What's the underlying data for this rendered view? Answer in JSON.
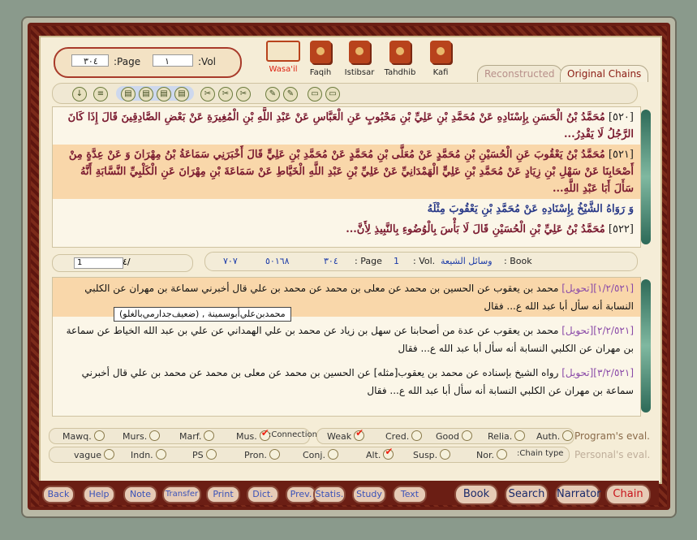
{
  "nav": {
    "page_label": ":Page",
    "vol_label": ":Vol",
    "page_value": "٣٠٤",
    "vol_value": "١"
  },
  "books": [
    {
      "label": "Wasa'il",
      "active": true
    },
    {
      "label": "Faqih"
    },
    {
      "label": "Istibsar"
    },
    {
      "label": "Tahdhib"
    },
    {
      "label": "Kafi"
    }
  ],
  "tabs": {
    "reconstructed": "Reconstructed",
    "original": "Original Chains"
  },
  "text": {
    "p1_num": "[٥٢٠]",
    "p1": "مُحَمَّدُ بْنُ الْحَسَنِ بِإِسْنَادِهِ عَنْ مُحَمَّدِ بْنِ عَلِيِّ بْنِ مَحْبُوبٍ عَنِ الْعَبَّاسِ عَنْ عَبْدِ اللَّهِ بْنِ الْمُغِيرَةِ عَنْ بَعْضِ الصَّادِقِينَ قَالَ إِذَا كَانَ الرَّجُلُ لَا يَقْدِرُ...",
    "p2_num": "[٥٢١]",
    "p2": "مُحَمَّدُ بْنُ يَعْقُوبَ عَنِ الْحُسَيْنِ بْنِ مُحَمَّدٍ عَنْ مُعَلَّى بْنِ مُحَمَّدٍ عَنْ مُحَمَّدِ بْنِ عَلِيٍّ قَالَ أَخْبَرَنِي سَمَاعَةُ بْنُ مِهْرَانَ وَ عَنْ عِدَّةٍ مِنْ أَصْحَابِنَا عَنْ سَهْلِ بْنِ زِيَادٍ عَنْ مُحَمَّدِ بْنِ عَلِيٍّ الْهَمْدَانِيِّ عَنْ عَلِيِّ بْنِ عَبْدِ اللَّهِ الْخَيَّاطِ عَنْ سَمَاعَةَ بْنِ مِهْرَانَ عَنِ الْكَلْبِيِّ النَّسَّابَةِ أَنَّهُ سَأَلَ أَبَا عَبْدِ اللَّهِ...",
    "p3": "وَ رَوَاهُ الشَّيْخُ بِإِسْنَادِهِ عَنْ مُحَمَّدِ بْنِ يَعْقُوبَ مِثْلَهُ",
    "p4_num": "[٥٢٢]",
    "p4": "مُحَمَّدُ بْنُ عَلِيِّ بْنِ الْحُسَيْنِ قَالَ لَا بَأْسَ بِالْوُضُوءِ بِالنَّبِيذِ لِأَنَّ..."
  },
  "info": {
    "book_label": ": Book",
    "book_name": "وسائل الشيعة",
    "vol_label": ": Vol.",
    "vol_value": "1",
    "page_label": ": Page",
    "page_value": "٣٠٤",
    "hadith_no": "٥٠١٦٨",
    "count": "٧٠٧"
  },
  "pager": {
    "total": "٤/",
    "current": "1"
  },
  "chains": {
    "c1_tag": "[١/٢/٥٢١][تحويل]",
    "c1": "محمد بن يعقوب عن الحسين بن محمد عن معلى بن محمد عن محمد بن علي قال أخبرني سماعة بن مهران عن الكلبي النسابة أنه سأل أبا عبد الله ع... فقال",
    "c2_tag": "[٢/٢/٥٢١][تحويل]",
    "c2": "محمد بن يعقوب عن عدة من أصحابنا عن سهل بن زياد عن محمد بن علي الهمداني عن علي بن عبد الله الخياط عن سماعة بن مهران عن الكلبي النسابة أنه سأل أبا عبد الله ع... فقال",
    "c3_tag": "[٣/٢/٥٢١][تحويل]",
    "c3": "رواه الشيخ بإسناده عن محمد بن يعقوب[مثله] عن الحسين بن محمد عن معلى بن محمد عن محمد بن علي قال أخبرني سماعة بن مهران عن الكلبي النسابة أنه سأل أبا عبد الله ع... فقال",
    "tooltip": "محمدبن‌علي‌أبوسمينة , (ضعيف‌جدا‌رمي‌بالغلو)"
  },
  "eval_row1": {
    "mawq": "Mawq.",
    "murs": "Murs.",
    "marf": "Marf.",
    "mus": "Mus.",
    "connection": ":Connection",
    "weak": "Weak",
    "cred": "Cred.",
    "good": "Good",
    "relia": "Relia.",
    "auth": "Auth.",
    "program": "Program's eval."
  },
  "eval_row2": {
    "vague": "vague",
    "indn": "Indn.",
    "ps": "PS",
    "pron": "Pron.",
    "conj": "Conj.",
    "alt": "Alt.",
    "susp": "Susp.",
    "nor": "Nor.",
    "chaintype": ":Chain type",
    "personal": "Personal's eval."
  },
  "buttons": {
    "back": "Back",
    "help": "Help",
    "note": "Note",
    "transfer": "Transfer",
    "print": "Print",
    "dict": "Dict.",
    "prev": "Prev.",
    "statis": "Statis.",
    "study": "Study",
    "text": "Text",
    "book": "Book",
    "search": "Search",
    "narrator": "Narrator",
    "chain": "Chain"
  }
}
